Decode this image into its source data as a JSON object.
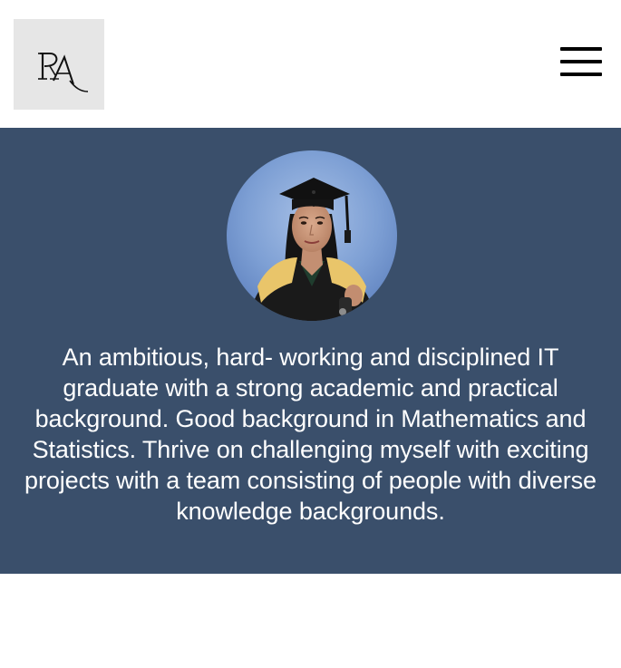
{
  "header": {
    "logo_text": "RA",
    "menu_icon": "hamburger-menu-icon"
  },
  "profile": {
    "photo_alt": "Graduation portrait",
    "bio": "An ambitious, hard- working and disciplined IT graduate with a strong academic and practical background. Good background in Mathematics and Statistics. Thrive on challenging myself with exciting projects with a team consisting of people with diverse knowledge backgrounds."
  },
  "colors": {
    "hero_background": "#3a4f6b",
    "logo_background": "#e6e6e6",
    "text": "#ffffff"
  }
}
